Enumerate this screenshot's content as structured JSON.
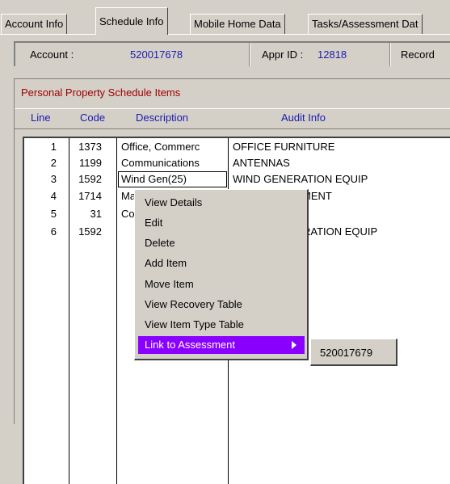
{
  "tabs": [
    {
      "label": "Account Info",
      "active": false
    },
    {
      "label": "Schedule Info",
      "active": true
    },
    {
      "label": "Mobile Home Data",
      "active": false
    },
    {
      "label": "Tasks/Assessment Dat",
      "active": false
    }
  ],
  "header": {
    "account_label": "Account :",
    "account_value": "520017678",
    "appr_label": "Appr ID :",
    "appr_value": "12818",
    "record_label": "Record"
  },
  "section": {
    "title": "Personal Property Schedule Items",
    "columns": [
      "Line",
      "Code",
      "Description",
      "Audit Info"
    ]
  },
  "rows": [
    {
      "line": "1",
      "code": "1373",
      "description": "Office, Commerc",
      "audit": "OFFICE FURNITURE"
    },
    {
      "line": "2",
      "code": "1199",
      "description": "Communications",
      "audit": "ANTENNAS"
    },
    {
      "line": "3",
      "code": "1592",
      "description": "Wind Gen(25)",
      "audit": "WIND GENERATION EQUIP"
    },
    {
      "line": "4",
      "code": "1714",
      "description": "Ma",
      "audit": "MENT"
    },
    {
      "line": "5",
      "code": "31",
      "description": "Co",
      "audit": ""
    },
    {
      "line": "6",
      "code": "1592",
      "description": "",
      "audit": "RATION EQUIP"
    }
  ],
  "context_menu": {
    "items": [
      "View Details",
      "Edit",
      "Delete",
      "Add Item",
      "Move Item",
      "View Recovery Table",
      "View Item Type Table",
      "Link to Assessment"
    ],
    "highlighted_index": 7,
    "highlight_color": "#8a00ff"
  },
  "submenu": {
    "items": [
      "520017679"
    ]
  },
  "colors": {
    "background": "#d4d0c8",
    "title_red": "#a00000",
    "value_blue": "#1a1ab0"
  }
}
